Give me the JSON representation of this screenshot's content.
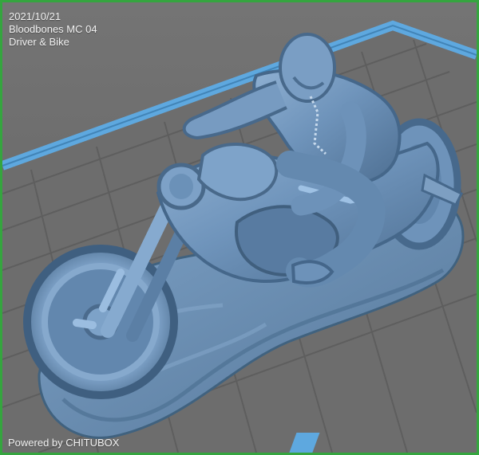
{
  "window": {
    "border_color": "#35a53f",
    "viewport_color": "#6f6f6f",
    "platform_edge_color": "#5ea8df",
    "model_color": "#6f94bb"
  },
  "overlay": {
    "date": "2021/10/21",
    "model_name": "Bloodbones MC 04",
    "model_subtitle": "Driver & Bike",
    "powered_by": "Powered by CHITUBOX"
  },
  "scene": {
    "grid": true,
    "platform_visible": true,
    "model_description_hidden": true
  }
}
